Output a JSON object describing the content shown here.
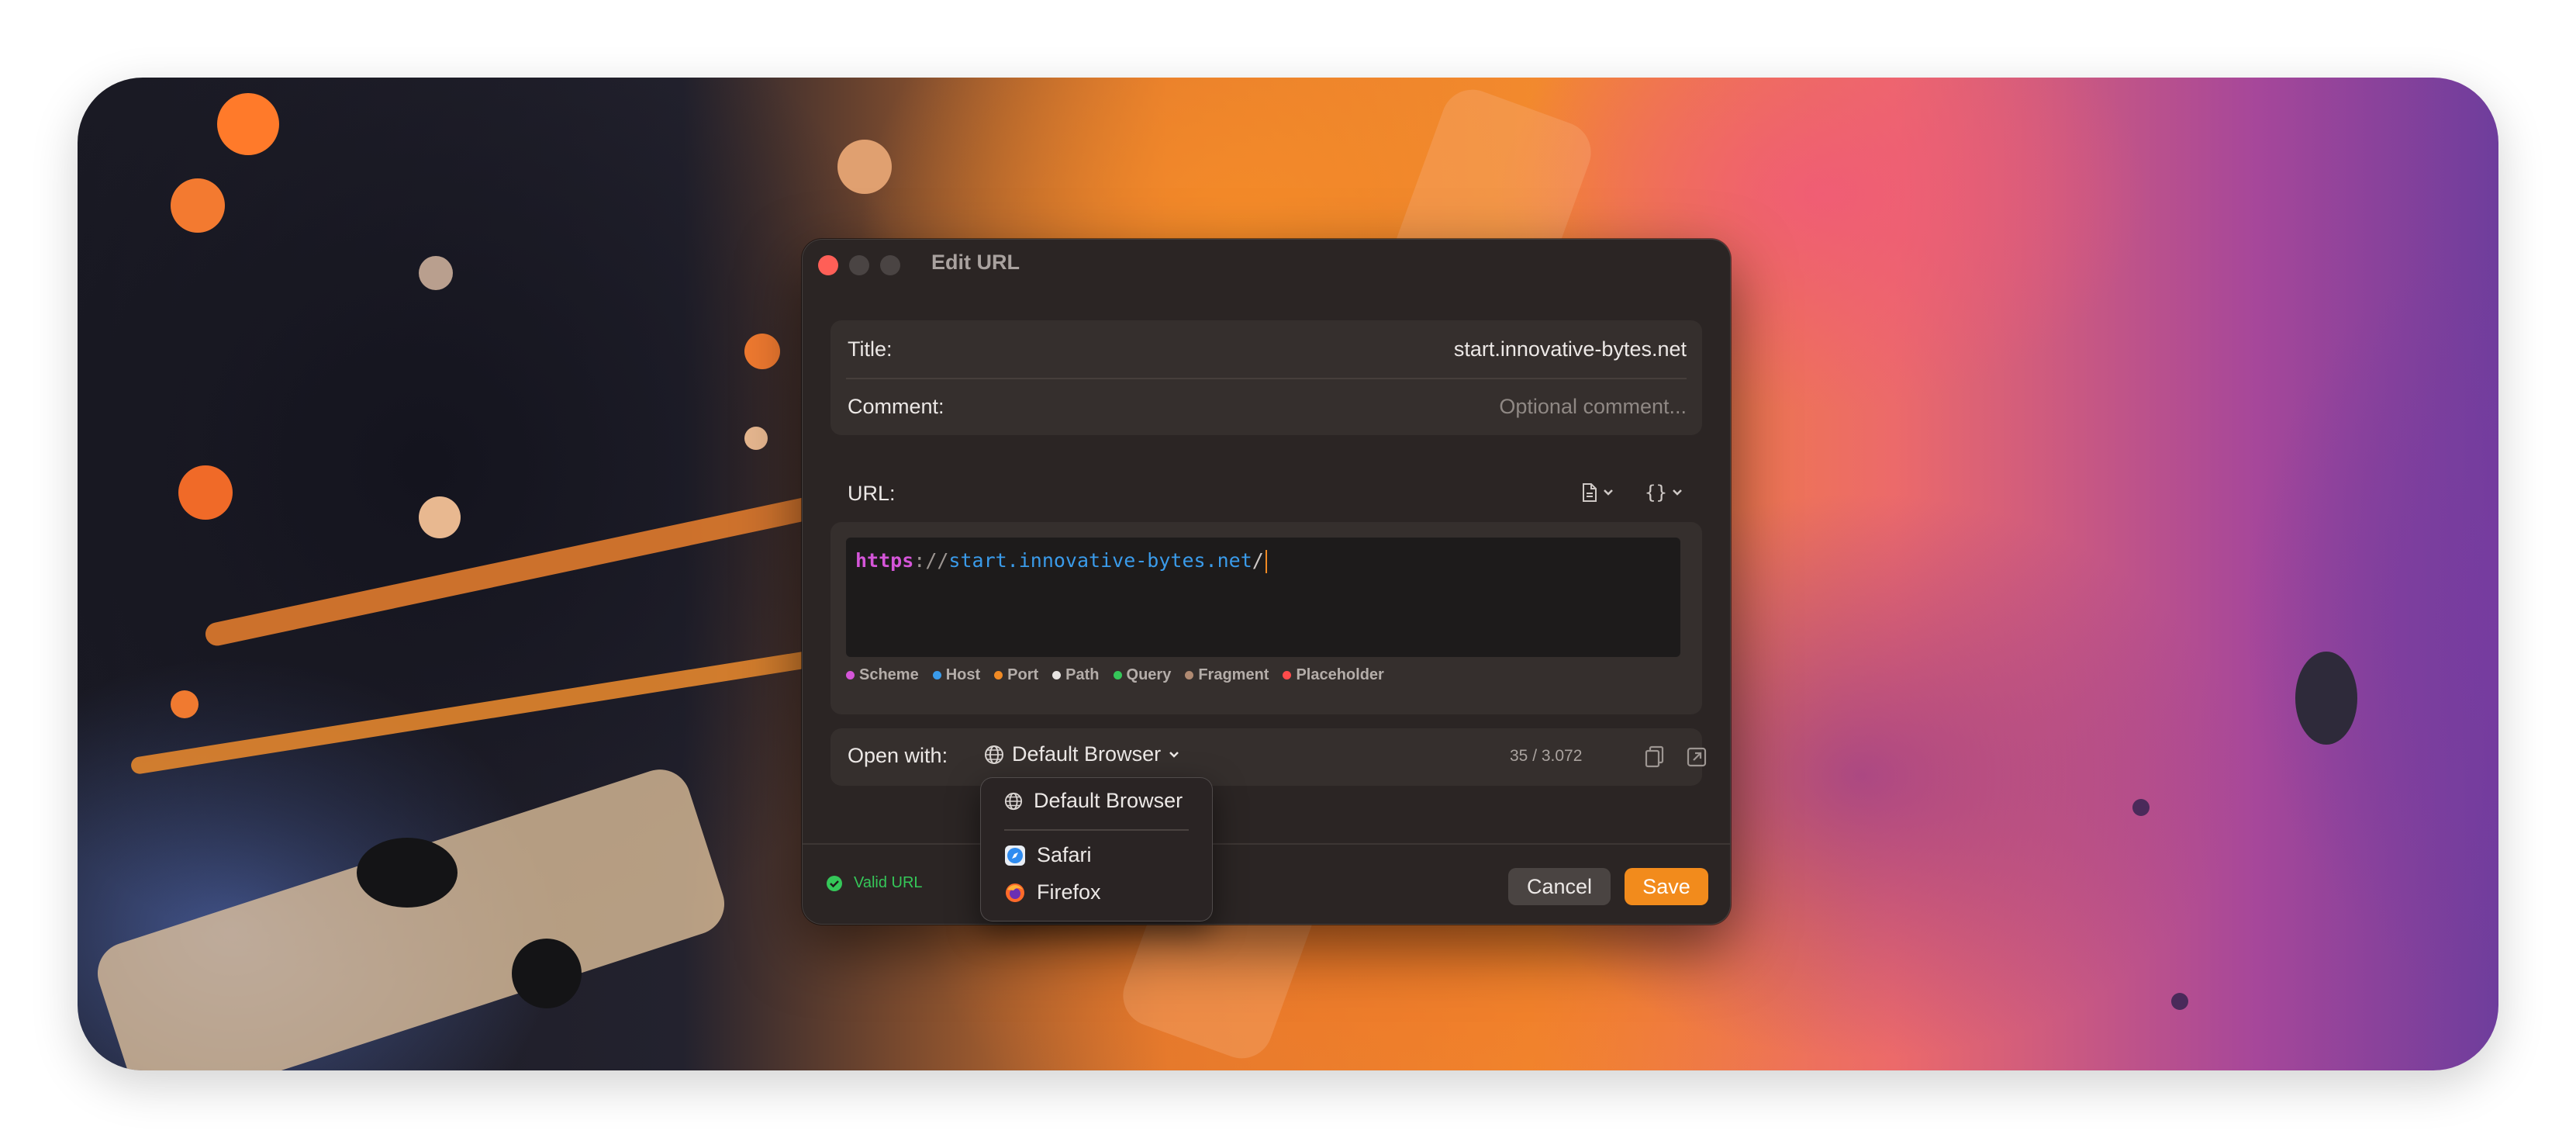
{
  "dialog": {
    "title": "Edit URL",
    "title_field": {
      "label": "Title:",
      "value": "start.innovative-bytes.net"
    },
    "comment_field": {
      "label": "Comment:",
      "placeholder": "Optional comment..."
    },
    "url_label": "URL:",
    "url_tokens": {
      "scheme": "https",
      "separator": "://",
      "host": "start.innovative-bytes.net",
      "path": "/"
    },
    "legend": [
      {
        "label": "Scheme",
        "color": "#d455d8"
      },
      {
        "label": "Host",
        "color": "#3a9bea"
      },
      {
        "label": "Port",
        "color": "#f08a24"
      },
      {
        "label": "Path",
        "color": "#e8e4e2"
      },
      {
        "label": "Query",
        "color": "#35c759"
      },
      {
        "label": "Fragment",
        "color": "#b08a72"
      },
      {
        "label": "Placeholder",
        "color": "#ff4b4b"
      }
    ],
    "open_with": {
      "label": "Open with:",
      "selected": "Default Browser",
      "count": "35 / 3.072"
    },
    "status": "Valid URL",
    "cancel_label": "Cancel",
    "save_label": "Save"
  },
  "menu": {
    "items": [
      {
        "label": "Default Browser",
        "icon": "globe-icon"
      },
      {
        "label": "Safari",
        "icon": "safari-icon"
      },
      {
        "label": "Firefox",
        "icon": "firefox-icon"
      }
    ]
  },
  "colors": {
    "accent": "#f28b1c",
    "valid": "#35c759",
    "close": "#ff5f57"
  }
}
